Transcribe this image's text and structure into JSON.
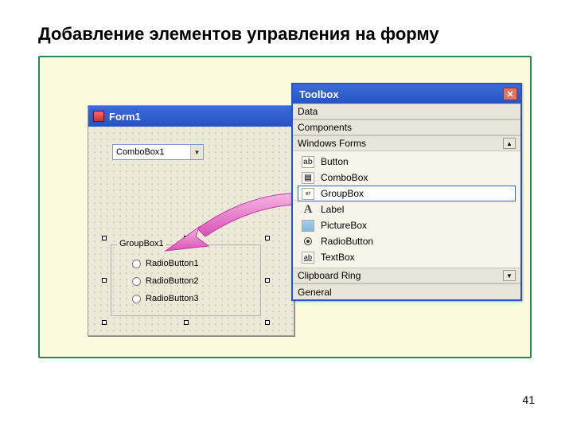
{
  "slide": {
    "title": "Добавление элементов управления на форму",
    "page_number": "41"
  },
  "form": {
    "title": "Form1",
    "combo_text": "ComboBox1",
    "groupbox_legend": "GroupBox1",
    "radios": [
      "RadioButton1",
      "RadioButton2",
      "RadioButton3"
    ]
  },
  "toolbox": {
    "title": "Toolbox",
    "sections": {
      "data": "Data",
      "components": "Components",
      "windows_forms": "Windows Forms",
      "clipboard_ring": "Clipboard Ring",
      "general": "General"
    },
    "items": [
      {
        "icon": "ab",
        "label": "Button"
      },
      {
        "icon": "cb",
        "label": "ComboBox"
      },
      {
        "icon": "xy",
        "label": "GroupBox"
      },
      {
        "icon": "A",
        "label": "Label"
      },
      {
        "icon": "pic",
        "label": "PictureBox"
      },
      {
        "icon": "rad",
        "label": "RadioButton"
      },
      {
        "icon": "tb",
        "label": "TextBox"
      }
    ]
  }
}
